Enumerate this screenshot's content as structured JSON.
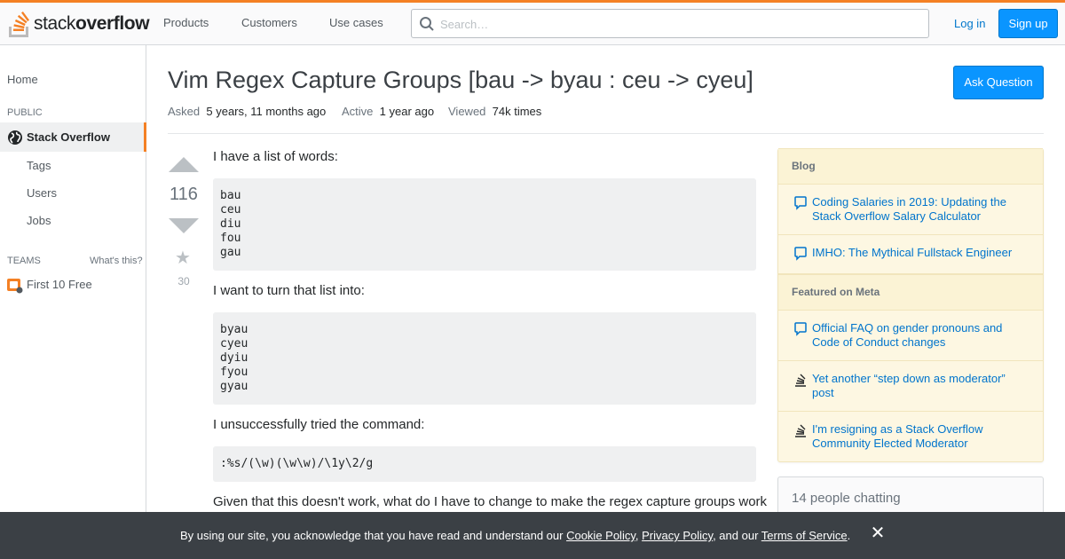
{
  "header": {
    "logo_light": "stack",
    "logo_bold": "overflow",
    "nav": [
      "Products",
      "Customers",
      "Use cases"
    ],
    "search_placeholder": "Search…",
    "login_label": "Log in",
    "signup_label": "Sign up",
    "accent_color": "#f48024",
    "button_color": "#0a95ff"
  },
  "sidebar": {
    "home": "Home",
    "public_label": "PUBLIC",
    "active_item": "Stack Overflow",
    "items": [
      "Tags",
      "Users",
      "Jobs"
    ],
    "teams_label": "TEAMS",
    "whats_this": "What's this?",
    "teams_item": "First 10 Free"
  },
  "question": {
    "title": "Vim Regex Capture Groups [bau -> byau : ceu -> cyeu]",
    "ask_button": "Ask Question",
    "asked_label": "Asked",
    "asked_value": "5 years, 11 months ago",
    "active_label": "Active",
    "active_value": "1 year ago",
    "viewed_label": "Viewed",
    "viewed_value": "74k times",
    "votes": "116",
    "favorites": "30",
    "body": {
      "p1": "I have a list of words:",
      "code1": [
        "bau",
        "ceu",
        "diu",
        "fou",
        "gau"
      ],
      "p2": "I want to turn that list into:",
      "code2": [
        "byau",
        "cyeu",
        "dyiu",
        "fyou",
        "gyau"
      ],
      "p3": "I unsuccessfully tried the command:",
      "code3": ":%s/(\\w)(\\w\\w)/\\1y\\2/g",
      "p4": "Given that this doesn't work, what do I have to change to make the regex capture groups work"
    }
  },
  "right_sidebar": {
    "blog_header": "Blog",
    "blog_items": [
      "Coding Salaries in 2019: Updating the Stack Overflow Salary Calculator",
      "IMHO: The Mythical Fullstack Engineer"
    ],
    "meta_header": "Featured on Meta",
    "meta_items": [
      "Official FAQ on gender pronouns and Code of Conduct changes",
      "Yet another “step down as moderator” post",
      "I'm resigning as a Stack Overflow Community Elected Moderator"
    ],
    "chat_text": "14 people chatting"
  },
  "cookie_bar": {
    "prefix": "By using our site, you acknowledge that you have read and understand our",
    "cookie_policy": "Cookie Policy",
    "comma": ",",
    "privacy_policy": "Privacy Policy",
    "and_our": ", and our",
    "terms": "Terms of Service",
    "period": "."
  }
}
